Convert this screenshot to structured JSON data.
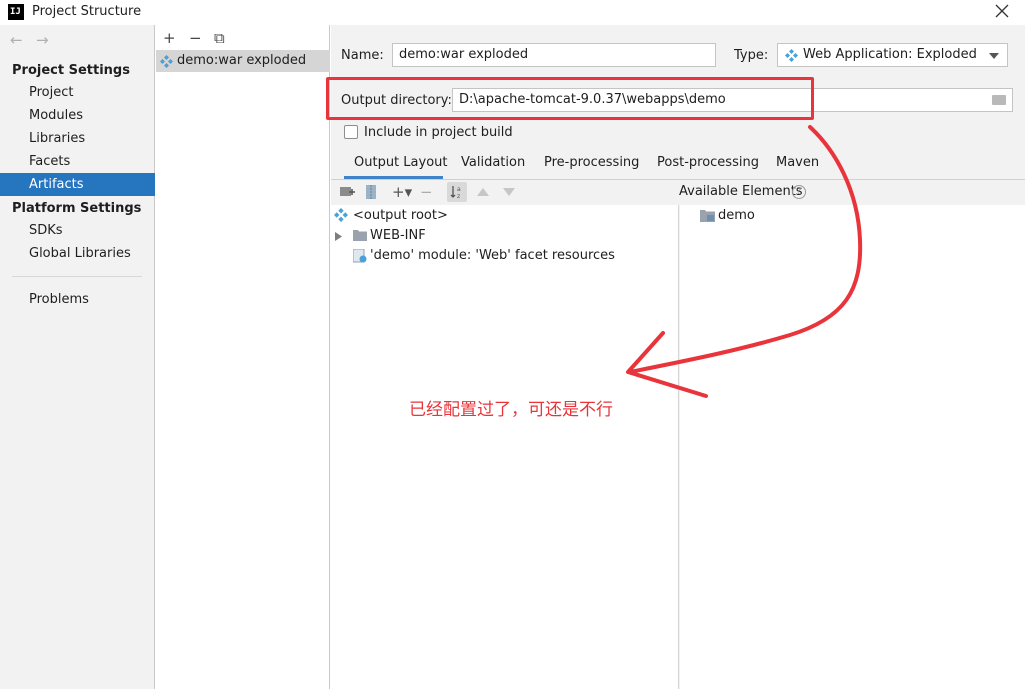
{
  "window": {
    "title": "Project Structure",
    "icon_text": "IJ"
  },
  "left_panel": {
    "nav": {
      "back": "←",
      "forward": "→"
    },
    "project_settings_header": "Project Settings",
    "project_items": [
      "Project",
      "Modules",
      "Libraries",
      "Facets",
      "Artifacts"
    ],
    "selected_item": "Artifacts",
    "platform_settings_header": "Platform Settings",
    "platform_items": [
      "SDKs",
      "Global Libraries"
    ],
    "problems": "Problems"
  },
  "middle_panel": {
    "toolbar": {
      "add": "+",
      "remove": "−",
      "copy": "⧉"
    },
    "artifact": "demo:war exploded"
  },
  "artifact_editor": {
    "name_label": "Name:",
    "name_value": "demo:war exploded",
    "type_label": "Type:",
    "type_value": "Web Application: Exploded",
    "output_dir_label": "Output directory:",
    "output_dir_value": "D:\\apache-tomcat-9.0.37\\webapps\\demo",
    "include_build_label": "Include in project build",
    "tabs": [
      "Output Layout",
      "Validation",
      "Pre-processing",
      "Post-processing",
      "Maven"
    ],
    "active_tab": "Output Layout",
    "available_elements_label": "Available Elements",
    "help": "?",
    "tree": {
      "root": "<output root>",
      "web_inf": "WEB-INF",
      "facet": "'demo' module: 'Web' facet resources"
    },
    "available": [
      "demo"
    ]
  },
  "annotation": {
    "text": "已经配置过了，可还是不行",
    "color": "#e8343a"
  }
}
